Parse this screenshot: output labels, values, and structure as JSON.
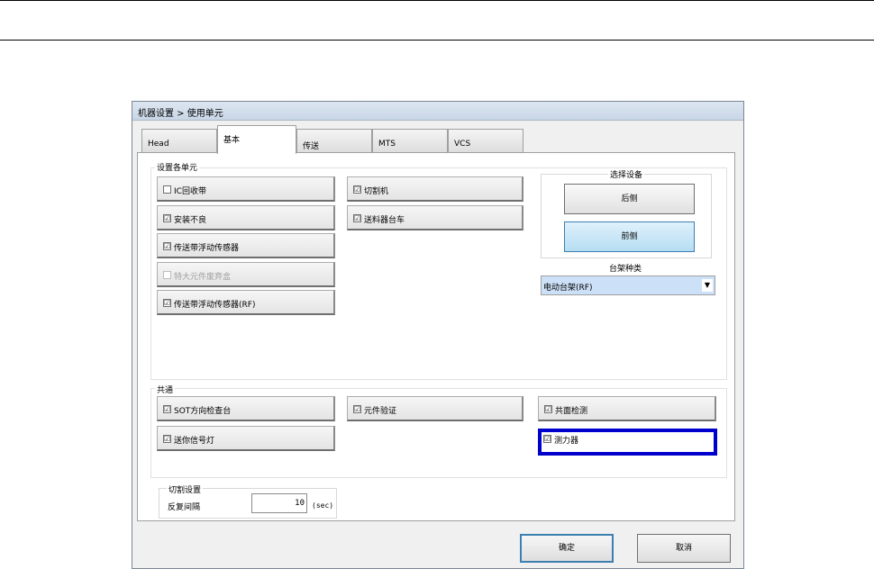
{
  "dialog": {
    "title": "机器设置 > 使用单元",
    "tabs": [
      {
        "label": "Head",
        "active": false
      },
      {
        "label": "基本",
        "active": true
      },
      {
        "label": "传送",
        "active": false
      },
      {
        "label": "MTS",
        "active": false
      },
      {
        "label": "VCS",
        "active": false
      }
    ],
    "unit_group": {
      "label": "设置各单元",
      "items": [
        {
          "label": "IC回收带",
          "checked": false,
          "enabled": true
        },
        {
          "label": "安装不良",
          "checked": true,
          "enabled": true
        },
        {
          "label": "传送带浮动传感器",
          "checked": true,
          "enabled": true
        },
        {
          "label": "特大元件废弃盒",
          "checked": false,
          "enabled": false
        },
        {
          "label": "传送带浮动传感器(RF)",
          "checked": true,
          "enabled": true
        },
        {
          "label": "切割机",
          "checked": true,
          "enabled": true
        },
        {
          "label": "送料器台车",
          "checked": true,
          "enabled": true
        }
      ]
    },
    "device_group": {
      "label": "选择设备",
      "rear_label": "后侧",
      "front_label": "前侧",
      "selected": "前侧"
    },
    "cart_type": {
      "label": "台架种类",
      "value": "电动台架(RF)"
    },
    "common_group": {
      "label": "共通",
      "items": [
        {
          "label": "SOT方向检查台",
          "checked": true
        },
        {
          "label": "送你信号灯",
          "checked": true
        },
        {
          "label": "元件验证",
          "checked": true
        },
        {
          "label": "共面检测",
          "checked": true
        },
        {
          "label": "测力器",
          "checked": true
        }
      ]
    },
    "cut_settings": {
      "label": "切割设置",
      "interval_label": "反复间隔",
      "interval_value": "10",
      "unit": "(sec)"
    },
    "buttons": {
      "ok": "确定",
      "cancel": "取消"
    },
    "check_mark": "☑",
    "colors": {
      "highlight": "#0000cc",
      "selected_button": "#b6ddf3",
      "combo_bg": "#cce0f7"
    }
  }
}
